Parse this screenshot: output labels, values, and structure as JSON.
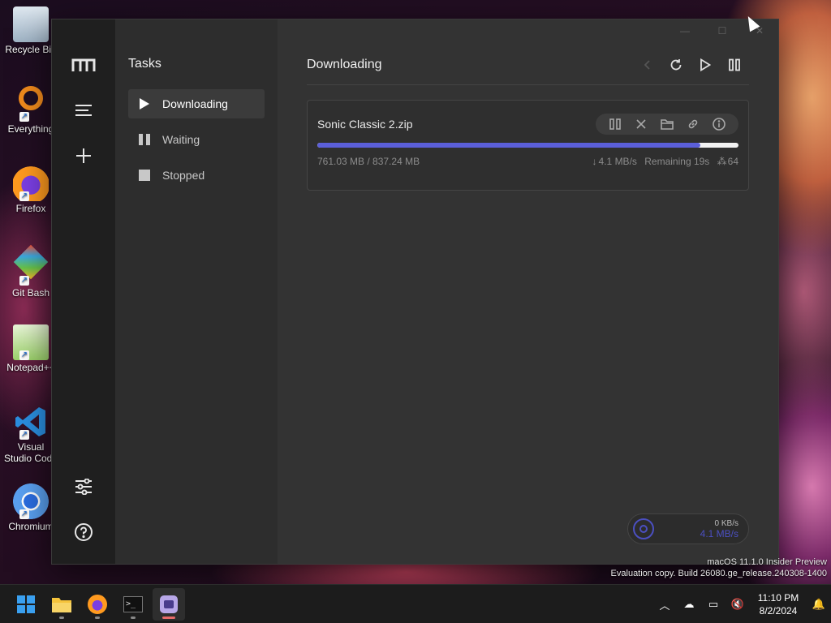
{
  "desktop": {
    "icons": [
      {
        "label": "Recycle Bin",
        "icon": "recycle-bin-icon"
      },
      {
        "label": "Everything",
        "icon": "everything-icon"
      },
      {
        "label": "Firefox",
        "icon": "firefox-icon"
      },
      {
        "label": "Git Bash",
        "icon": "git-bash-icon"
      },
      {
        "label": "Notepad++",
        "icon": "notepad-plus-plus-icon"
      },
      {
        "label": "Visual Studio Code",
        "icon": "vscode-icon"
      },
      {
        "label": "Chromium",
        "icon": "chromium-icon"
      }
    ],
    "watermark_line1": "macOS 11.1.0 Insider Preview",
    "watermark_line2": "Evaluation copy. Build 26080.ge_release.240308-1400"
  },
  "app": {
    "sidebar": {
      "title": "Tasks",
      "items": [
        {
          "label": "Downloading",
          "icon": "play-icon",
          "active": true
        },
        {
          "label": "Waiting",
          "icon": "pause-icon",
          "active": false
        },
        {
          "label": "Stopped",
          "icon": "stop-icon",
          "active": false
        }
      ]
    },
    "main": {
      "title": "Downloading",
      "toolbar": [
        "back-icon",
        "refresh-icon",
        "resume-all-icon",
        "pause-all-icon"
      ]
    },
    "task": {
      "filename": "Sonic Classic 2.zip",
      "progress": 0.909,
      "size_text": "761.03 MB / 837.24 MB",
      "speed": "4.1 MB/s",
      "remaining": "Remaining 19s",
      "connections": "64",
      "actions": [
        "pause-icon",
        "close-icon",
        "folder-icon",
        "link-icon",
        "info-icon"
      ]
    },
    "speed_widget": {
      "upload": "0 KB/s",
      "download": "4.1 MB/s"
    },
    "colors": {
      "accent": "#5b5fd9",
      "background": "#333333",
      "sidebar": "#2d2d2d",
      "rail": "#1f1f1f"
    }
  },
  "taskbar": {
    "apps": [
      "windows-start-icon",
      "file-explorer-icon",
      "firefox-icon",
      "terminal-icon",
      "motrix-icon"
    ],
    "time": "11:10 PM",
    "date": "8/2/2024"
  }
}
